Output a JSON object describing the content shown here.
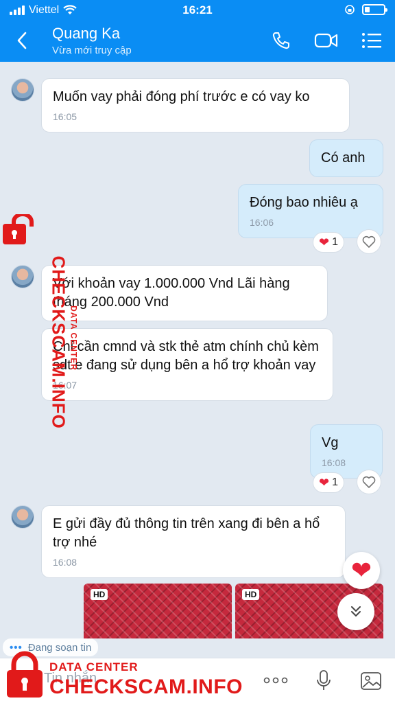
{
  "status_bar": {
    "carrier": "Viettel",
    "time": "16:21"
  },
  "header": {
    "contact_name": "Quang Ka",
    "contact_status": "Vừa mới truy cập"
  },
  "messages": [
    {
      "direction": "in",
      "text": "Muốn vay phải đóng phí trước e có vay ko",
      "time": "16:05"
    },
    {
      "direction": "out",
      "text": "Có anh"
    },
    {
      "direction": "out",
      "text": "Đóng bao nhiêu ạ",
      "time": "16:06",
      "reaction_count": "1"
    },
    {
      "direction": "in",
      "text": "Với khoản vay 1.000.000 Vnd Lãi hàng tháng 200.000 Vnd"
    },
    {
      "direction": "in",
      "text": "Chỉ cần cmnd và stk thẻ atm chính chủ kèm sdt e đang sử dụng bên a hổ trợ khoản vay",
      "time": "16:07"
    },
    {
      "direction": "out",
      "text": "Vg",
      "time": "16:08",
      "reaction_count": "1"
    },
    {
      "direction": "in",
      "text": "E gửi đầy đủ thông tin trên xang đi bên a hổ trợ nhé",
      "time": "16:08"
    }
  ],
  "images": [
    {
      "badge": "HD"
    },
    {
      "badge": "HD"
    }
  ],
  "typing_indicator": "Đang soạn tin",
  "input": {
    "placeholder": "Tin nhắn"
  },
  "watermark": {
    "small": "DATA CENTER",
    "big": "CHECKSCAM.INFO"
  },
  "colors": {
    "header": "#0a8df4",
    "incoming": "#ffffff",
    "outgoing": "#d5ecfb",
    "reaction_heart": "#e8243c",
    "watermark": "#e11a1a"
  },
  "icons": [
    "back-icon",
    "phone-icon",
    "video-call-icon",
    "menu-icon",
    "heart-icon",
    "like-icon",
    "chevron-down-icon",
    "more-icon",
    "mic-icon",
    "image-icon",
    "lock-icon"
  ]
}
